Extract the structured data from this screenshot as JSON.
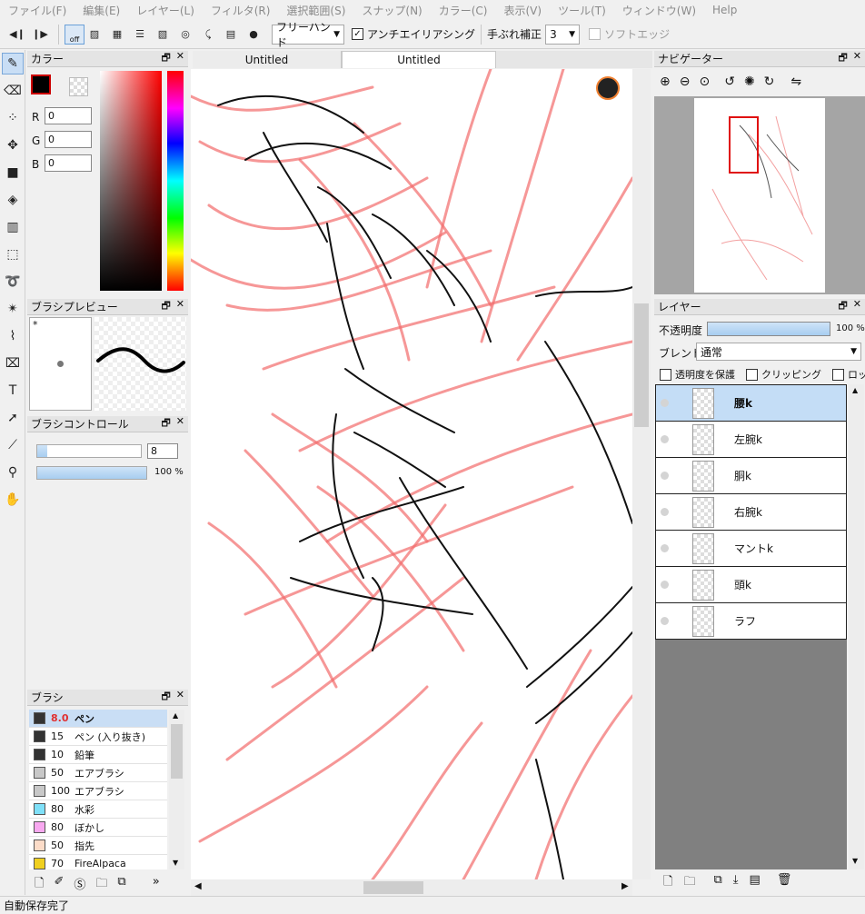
{
  "menu": [
    "ファイル(F)",
    "編集(E)",
    "レイヤー(L)",
    "フィルタ(R)",
    "選択範囲(S)",
    "スナップ(N)",
    "カラー(C)",
    "表示(V)",
    "ツール(T)",
    "ウィンドウ(W)",
    "Help"
  ],
  "toolbar": {
    "snap_off": "off",
    "draw_mode": "フリーハンド",
    "antialias_label": "アンチエイリアシング",
    "stabilizer_label": "手ぶれ補正",
    "stabilizer_value": "3",
    "soft_edge_label": "ソフトエッジ"
  },
  "color_panel": {
    "title": "カラー",
    "r_label": "R",
    "r_value": "0",
    "g_label": "G",
    "g_value": "0",
    "b_label": "B",
    "b_value": "0",
    "foreground": "#000000",
    "background": "#ffffff"
  },
  "brush_preview": {
    "title": "ブラシプレビュー",
    "marker": "*"
  },
  "brush_control": {
    "title": "ブラシコントロール",
    "size_value": "8",
    "opacity_value": "100 %",
    "size_fraction": 0.1,
    "opacity_fraction": 1.0
  },
  "brush_list": {
    "title": "ブラシ",
    "items": [
      {
        "size": "8.0",
        "name": "ペン",
        "color": "#333333"
      },
      {
        "size": "15",
        "name": "ペン (入り抜き)",
        "color": "#333333"
      },
      {
        "size": "10",
        "name": "鉛筆",
        "color": "#333333"
      },
      {
        "size": "50",
        "name": "エアブラシ",
        "color": "#c8c8c8"
      },
      {
        "size": "100",
        "name": "エアブラシ",
        "color": "#c8c8c8"
      },
      {
        "size": "80",
        "name": "水彩",
        "color": "#7fe0f8"
      },
      {
        "size": "80",
        "name": "ぼかし",
        "color": "#f8a8f0"
      },
      {
        "size": "50",
        "name": "指先",
        "color": "#fcdcc8"
      },
      {
        "size": "70",
        "name": "FireAlpaca",
        "color": "#f0d020"
      }
    ],
    "more": "»"
  },
  "tabs": [
    "Untitled",
    "Untitled"
  ],
  "navigator": {
    "title": "ナビゲーター"
  },
  "layers": {
    "title": "レイヤー",
    "opacity_label": "不透明度",
    "opacity_value": "100 %",
    "opacity_fraction": 1.0,
    "blend_label": "ブレンド",
    "blend_value": "通常",
    "protect_label": "透明度を保護",
    "clip_label": "クリッピング",
    "lock_label": "ロック",
    "items": [
      "腰k",
      "左腕k",
      "胴k",
      "右腕k",
      "マントk",
      "頭k",
      "ラフ"
    ]
  },
  "status": {
    "text": "自動保存完了"
  }
}
